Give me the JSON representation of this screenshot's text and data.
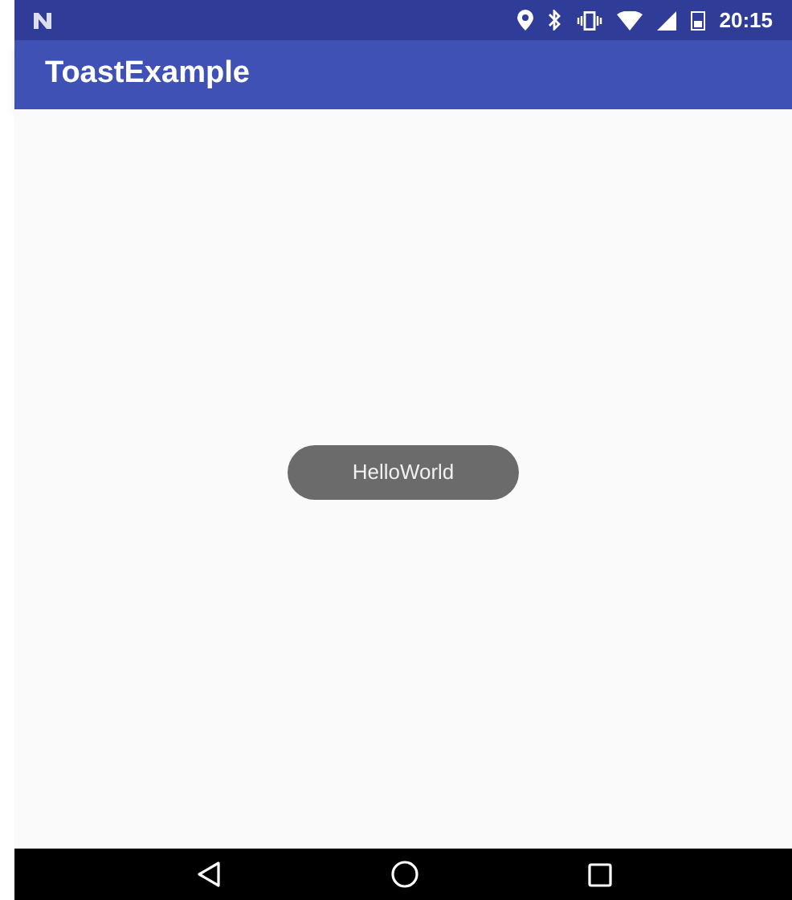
{
  "status_bar": {
    "time": "20:15"
  },
  "app_bar": {
    "title": "ToastExample"
  },
  "toast": {
    "text": "HelloWorld"
  }
}
